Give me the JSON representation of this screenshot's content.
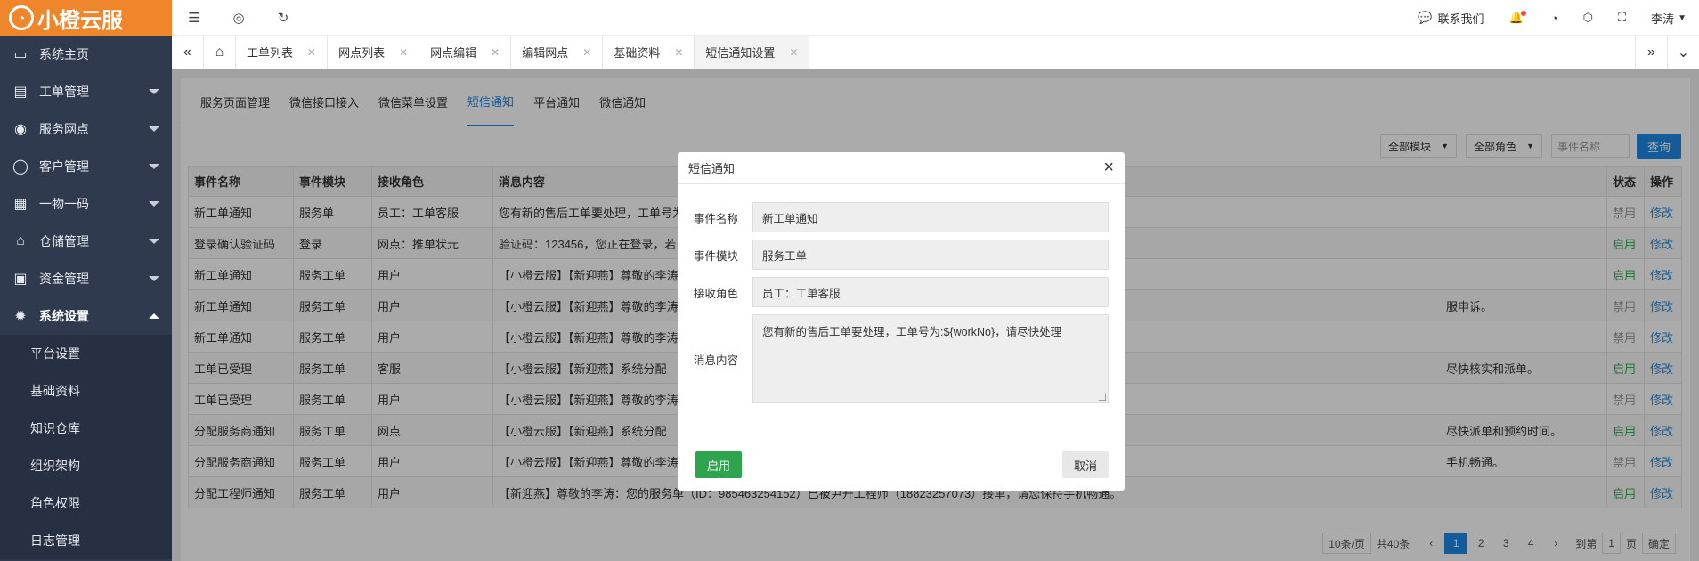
{
  "brand": {
    "name": "小橙云服",
    "accent": "#f0862b"
  },
  "sidebar": {
    "items": [
      {
        "label": "系统主页",
        "icon": "monitor-icon",
        "glyph": "▭"
      },
      {
        "label": "工单管理",
        "icon": "document-icon",
        "glyph": "▤"
      },
      {
        "label": "服务网点",
        "icon": "globe-icon",
        "glyph": "◉"
      },
      {
        "label": "客户管理",
        "icon": "user-icon",
        "glyph": "◯"
      },
      {
        "label": "一物一码",
        "icon": "grid-icon",
        "glyph": "▦"
      },
      {
        "label": "仓储管理",
        "icon": "bank-icon",
        "glyph": "⌂"
      },
      {
        "label": "资金管理",
        "icon": "money-icon",
        "glyph": "▣"
      },
      {
        "label": "系统设置",
        "icon": "gear-icon",
        "glyph": "✹"
      }
    ],
    "sub_items": [
      "平台设置",
      "基础资料",
      "知识仓库",
      "组织架构",
      "角色权限",
      "日志管理"
    ]
  },
  "topbar": {
    "contact": "联系我们",
    "user": "李涛"
  },
  "tabs": [
    "工单列表",
    "网点列表",
    "网点编辑",
    "编辑网点",
    "基础资料",
    "短信通知设置"
  ],
  "subtabs": [
    "服务页面管理",
    "微信接口接入",
    "微信菜单设置",
    "短信通知",
    "平台通知",
    "微信通知"
  ],
  "filters": {
    "module": "全部模块",
    "role": "全部角色",
    "event_placeholder": "事件名称",
    "query": "查询"
  },
  "table": {
    "headers": [
      "事件名称",
      "事件模块",
      "接收角色",
      "消息内容",
      "状态",
      "操作"
    ],
    "rows": [
      [
        "新工单通知",
        "服务单",
        "员工：工单客服",
        "您有新的售后工单要处理，工单号为",
        "禁用",
        "修改"
      ],
      [
        "登录确认验证码",
        "登录",
        "网点：推单状元",
        "验证码：123456，您正在登录，若",
        "启用",
        "修改"
      ],
      [
        "新工单通知",
        "服务工单",
        "用户",
        "【小橙云服】【新迎燕】尊敬的李涛",
        "启用",
        "修改"
      ],
      [
        "新工单通知",
        "服务工单",
        "用户",
        "【小橙云服】【新迎燕】尊敬的李涛",
        "禁用",
        "修改"
      ],
      [
        "新工单通知",
        "服务工单",
        "用户",
        "【小橙云服】【新迎燕】尊敬的李涛",
        "禁用",
        "修改"
      ],
      [
        "工单已受理",
        "服务工单",
        "客服",
        "【小橙云服】【新迎燕】系统分配",
        "启用",
        "修改"
      ],
      [
        "工单已受理",
        "服务工单",
        "用户",
        "【小橙云服】【新迎燕】尊敬的李涛",
        "禁用",
        "修改"
      ],
      [
        "分配服务商通知",
        "服务工单",
        "网点",
        "【小橙云服】【新迎燕】系统分配",
        "启用",
        "修改"
      ],
      [
        "分配服务商通知",
        "服务工单",
        "用户",
        "【小橙云服】【新迎燕】尊敬的李涛",
        "禁用",
        "修改"
      ],
      [
        "分配工程师通知",
        "服务工单",
        "用户",
        "【新迎燕】尊敬的李涛：您的服务单（ID：985463254152）已被尹开工程师（18823257073）接单，请您保持手机畅通。",
        "启用",
        "修改"
      ]
    ],
    "content_tails": [
      "",
      "",
      "",
      "服申诉。",
      "",
      "尽快核实和派单。",
      "",
      "尽快派单和预约时间。",
      "手机畅通。",
      ""
    ]
  },
  "pager": {
    "per_page": "10条/页",
    "total": "共40条",
    "pages": [
      "1",
      "2",
      "3",
      "4"
    ],
    "goto": "到第",
    "page_input": "1",
    "page_unit": "页",
    "confirm": "确定"
  },
  "modal": {
    "title": "短信通知",
    "fields": {
      "event_name_label": "事件名称",
      "event_name": "新工单通知",
      "module_label": "事件模块",
      "module": "服务工单",
      "role_label": "接收角色",
      "role": "员工：工单客服",
      "content_label": "消息内容",
      "content": "您有新的售后工单要处理，工单号为:${workNo}，请尽快处理"
    },
    "enable": "启用",
    "cancel": "取消"
  }
}
